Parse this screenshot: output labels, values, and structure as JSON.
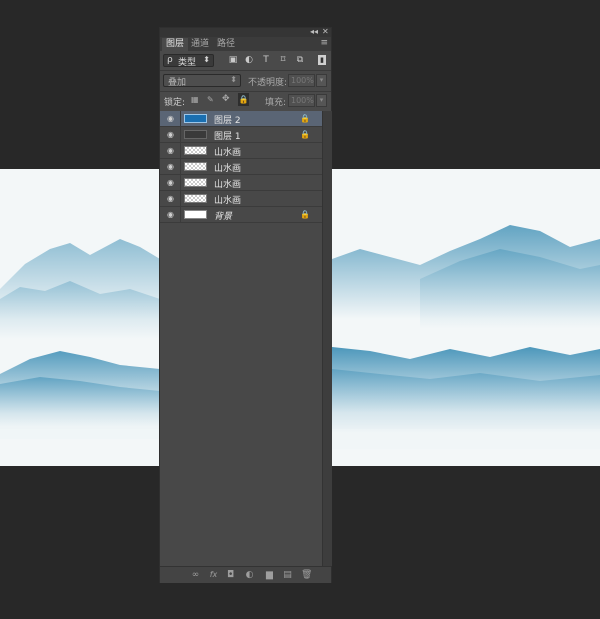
{
  "panel": {
    "collapse_glyph": "◂◂",
    "close_glyph": "✕",
    "menu_glyph": "≡",
    "tabs": [
      {
        "label": "图层",
        "active": true
      },
      {
        "label": "通道",
        "active": false
      },
      {
        "label": "路径",
        "active": false
      }
    ],
    "filter": {
      "search_glyph": "ρ",
      "kind_label": "类型",
      "arrow": "⬍"
    },
    "filter_icons": [
      "image-filter-icon",
      "adjustment-filter-icon",
      "type-filter-icon",
      "shape-filter-icon",
      "smart-object-filter-icon"
    ],
    "blend_mode": {
      "value": "叠加",
      "arrow": "⬍"
    },
    "opacity": {
      "label": "不透明度:",
      "value": "100%"
    },
    "lock": {
      "label": "锁定:"
    },
    "fill": {
      "label": "填充:",
      "value": "100%"
    },
    "layers": [
      {
        "name": "图层 2",
        "thumb": "blue",
        "locked": true,
        "selected": true,
        "italic": false
      },
      {
        "name": "图层 1",
        "thumb": "dark",
        "locked": true,
        "selected": false,
        "italic": false
      },
      {
        "name": "山水画",
        "thumb": "check",
        "locked": false,
        "selected": false,
        "italic": false
      },
      {
        "name": "山水画",
        "thumb": "check",
        "locked": false,
        "selected": false,
        "italic": false
      },
      {
        "name": "山水画",
        "thumb": "check",
        "locked": false,
        "selected": false,
        "italic": false
      },
      {
        "name": "山水画",
        "thumb": "check",
        "locked": false,
        "selected": false,
        "italic": false
      },
      {
        "name": "背景",
        "thumb": "white",
        "locked": true,
        "selected": false,
        "italic": true
      }
    ],
    "footer_icons": [
      "link-layers-icon",
      "fx-icon",
      "add-mask-icon",
      "adjustment-layer-icon",
      "new-group-icon",
      "new-layer-icon",
      "delete-icon"
    ],
    "footer_glyphs": [
      "∞",
      "fx",
      "◘",
      "◐",
      "▆",
      "▤",
      "🗑"
    ]
  },
  "colors": {
    "background": "#282828",
    "panel": "#4a4a4a",
    "selected_row": "#5a6575",
    "mountain_blue": "#3f8fb3"
  }
}
